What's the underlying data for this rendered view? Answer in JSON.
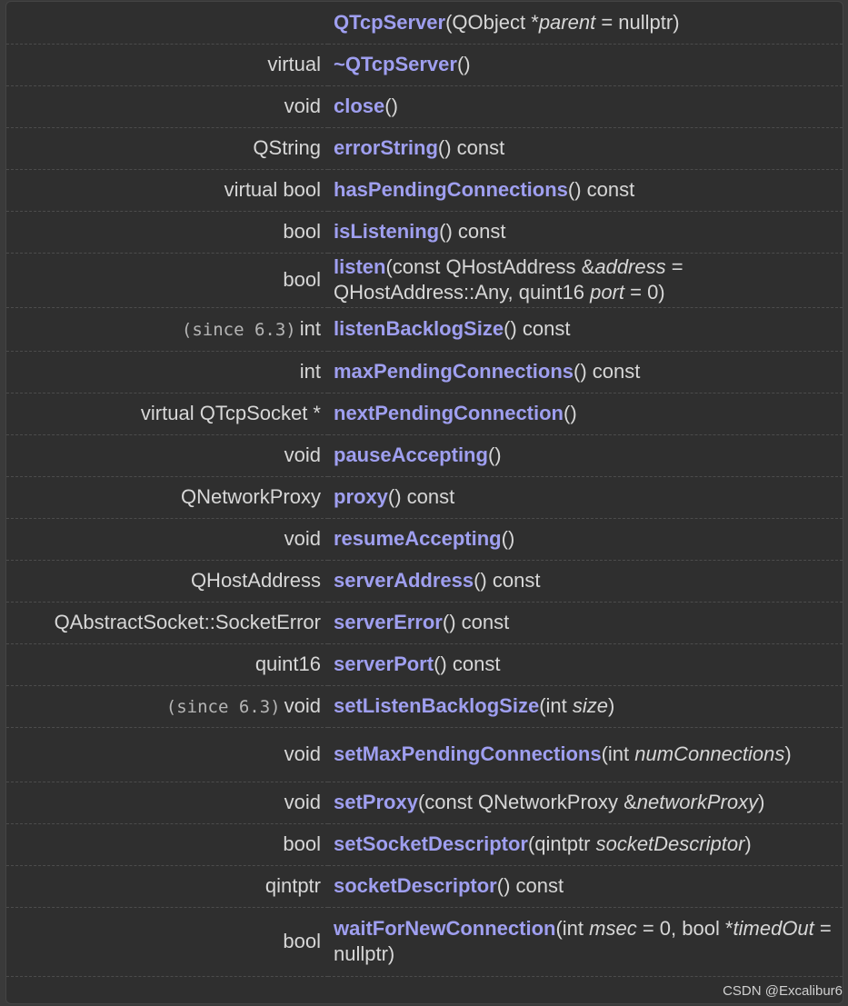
{
  "members": [
    {
      "ret": "",
      "since": "",
      "name": "QTcpServer",
      "sig": [
        [
          "t",
          "(QObject *"
        ],
        [
          "i",
          "parent"
        ],
        [
          "t",
          " = nullptr)"
        ]
      ]
    },
    {
      "ret": "virtual",
      "since": "",
      "name": "~QTcpServer",
      "sig": [
        [
          "t",
          "()"
        ]
      ]
    },
    {
      "ret": "void",
      "since": "",
      "name": "close",
      "sig": [
        [
          "t",
          "()"
        ]
      ]
    },
    {
      "ret": "QString",
      "since": "",
      "name": "errorString",
      "sig": [
        [
          "t",
          "() const"
        ]
      ]
    },
    {
      "ret": "virtual bool",
      "since": "",
      "name": "hasPendingConnections",
      "sig": [
        [
          "t",
          "() const"
        ]
      ]
    },
    {
      "ret": "bool",
      "since": "",
      "name": "isListening",
      "sig": [
        [
          "t",
          "() const"
        ]
      ]
    },
    {
      "ret": "bool",
      "since": "",
      "name": "listen",
      "sig": [
        [
          "t",
          "(const QHostAddress &"
        ],
        [
          "i",
          "address"
        ],
        [
          "t",
          " = QHostAddress::Any, quint16 "
        ],
        [
          "i",
          "port"
        ],
        [
          "t",
          " = 0)"
        ]
      ]
    },
    {
      "ret": "int",
      "since": "(since 6.3)",
      "name": "listenBacklogSize",
      "sig": [
        [
          "t",
          "() const"
        ]
      ]
    },
    {
      "ret": "int",
      "since": "",
      "name": "maxPendingConnections",
      "sig": [
        [
          "t",
          "() const"
        ]
      ]
    },
    {
      "ret": "virtual QTcpSocket *",
      "since": "",
      "name": "nextPendingConnection",
      "sig": [
        [
          "t",
          "()"
        ]
      ]
    },
    {
      "ret": "void",
      "since": "",
      "name": "pauseAccepting",
      "sig": [
        [
          "t",
          "()"
        ]
      ]
    },
    {
      "ret": "QNetworkProxy",
      "since": "",
      "name": "proxy",
      "sig": [
        [
          "t",
          "() const"
        ]
      ]
    },
    {
      "ret": "void",
      "since": "",
      "name": "resumeAccepting",
      "sig": [
        [
          "t",
          "()"
        ]
      ]
    },
    {
      "ret": "QHostAddress",
      "since": "",
      "name": "serverAddress",
      "sig": [
        [
          "t",
          "() const"
        ]
      ]
    },
    {
      "ret": "QAbstractSocket::SocketError",
      "since": "",
      "name": "serverError",
      "sig": [
        [
          "t",
          "() const"
        ]
      ]
    },
    {
      "ret": "quint16",
      "since": "",
      "name": "serverPort",
      "sig": [
        [
          "t",
          "() const"
        ]
      ]
    },
    {
      "ret": "void",
      "since": "(since 6.3)",
      "name": "setListenBacklogSize",
      "sig": [
        [
          "t",
          "(int "
        ],
        [
          "i",
          "size"
        ],
        [
          "t",
          ")"
        ]
      ]
    },
    {
      "ret": "void",
      "since": "",
      "name": "setMaxPendingConnections",
      "sig": [
        [
          "t",
          "(int "
        ],
        [
          "i",
          "numConnections"
        ],
        [
          "t",
          ")"
        ]
      ]
    },
    {
      "ret": "void",
      "since": "",
      "name": "setProxy",
      "sig": [
        [
          "t",
          "(const QNetworkProxy &"
        ],
        [
          "i",
          "networkProxy"
        ],
        [
          "t",
          ")"
        ]
      ]
    },
    {
      "ret": "bool",
      "since": "",
      "name": "setSocketDescriptor",
      "sig": [
        [
          "t",
          "(qintptr "
        ],
        [
          "i",
          "socketDescriptor"
        ],
        [
          "t",
          ")"
        ]
      ]
    },
    {
      "ret": "qintptr",
      "since": "",
      "name": "socketDescriptor",
      "sig": [
        [
          "t",
          "() const"
        ]
      ]
    },
    {
      "ret": "bool",
      "since": "",
      "name": "waitForNewConnection",
      "sig": [
        [
          "t",
          "(int "
        ],
        [
          "i",
          "msec"
        ],
        [
          "t",
          " = 0, bool *"
        ],
        [
          "i",
          "timedOut"
        ],
        [
          "t",
          " = nullptr)"
        ]
      ]
    }
  ],
  "watermark": "CSDN @Excalibur6",
  "colors": {
    "background": "#2f2f2f",
    "function_name": "#9f9ff0",
    "text": "#d7d7d7"
  }
}
